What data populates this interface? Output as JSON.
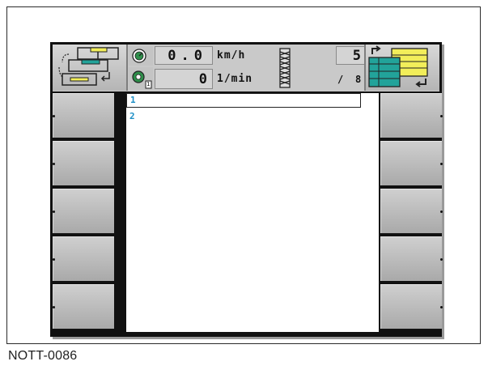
{
  "header": {
    "speed_value": "0.0",
    "speed_unit": "km/h",
    "rpm_value": "0",
    "rpm_unit": "1/min",
    "counter_top": "5",
    "counter_bottom_left": "/",
    "counter_bottom_right": "8",
    "rpm_badge": "1"
  },
  "rows": [
    {
      "label": "1"
    },
    {
      "label": "2"
    }
  ],
  "softkeys_left": [
    {
      "label": ""
    },
    {
      "label": ""
    },
    {
      "label": ""
    },
    {
      "label": ""
    },
    {
      "label": ""
    }
  ],
  "softkeys_right": [
    {
      "label": ""
    },
    {
      "label": ""
    },
    {
      "label": ""
    },
    {
      "label": ""
    },
    {
      "label": ""
    }
  ],
  "caption": "NOTT-0086",
  "colors": {
    "row_label": "#1d8fc6",
    "panel_yellow": "#f2ee5a",
    "panel_teal": "#22a39a"
  },
  "icons": {
    "left_header": "machine-layout-icon",
    "right_header": "view-switch-icon",
    "speed": "speedometer-icon",
    "rpm": "rpm-gauge-icon",
    "track": "tire-track-icon"
  }
}
